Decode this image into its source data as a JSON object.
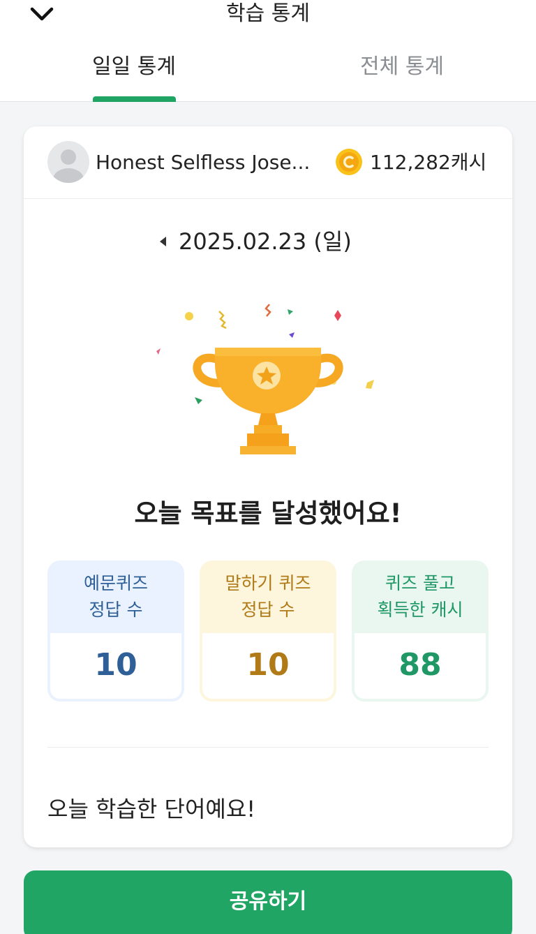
{
  "header": {
    "title": "학습 통계",
    "back_icon": "chevron-down-icon"
  },
  "tabs": [
    {
      "label": "일일 통계",
      "active": true
    },
    {
      "label": "전체 통계",
      "active": false
    }
  ],
  "colors": {
    "accent": "#1fa463",
    "quiz": "#2e5f97",
    "speak": "#b07a17",
    "cash": "#1f9866",
    "trophy": "#f7a823"
  },
  "user": {
    "name": "Honest Selfless Jose...",
    "cash": "112,282캐시",
    "coin_icon": "coin-icon"
  },
  "date": {
    "text": "2025.02.23 (일)",
    "prev_icon": "caret-left-icon"
  },
  "goal_message": "오늘 목표를 달성했어요!",
  "stats": [
    {
      "label_line1": "예문퀴즈",
      "label_line2": "정답 수",
      "value": "10"
    },
    {
      "label_line1": "말하기 퀴즈",
      "label_line2": "정답 수",
      "value": "10"
    },
    {
      "label_line1": "퀴즈 풀고",
      "label_line2": "획득한 캐시",
      "value": "88"
    }
  ],
  "words_title": "오늘 학습한 단어예요!",
  "share_label": "공유하기"
}
